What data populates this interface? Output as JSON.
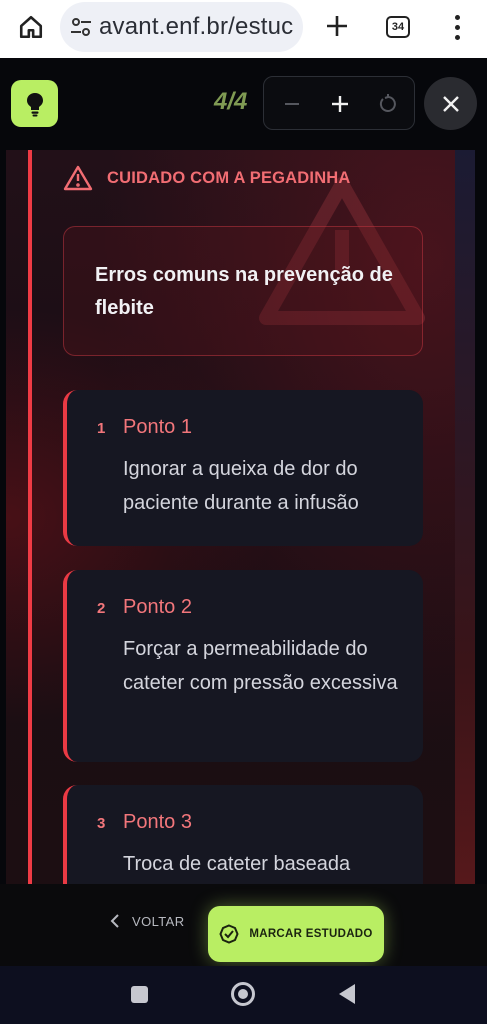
{
  "browser": {
    "url": "avant.enf.br/estuc",
    "tab_count": "34"
  },
  "app": {
    "counter": "4/4",
    "warning_label": "CUIDADO COM A PEGADINHA",
    "card_title": "Erros comuns na prevenção de flebite",
    "points": [
      {
        "number": "1",
        "title": "Ponto 1",
        "text": "Ignorar a queixa de dor do paciente durante a infusão"
      },
      {
        "number": "2",
        "title": "Ponto 2",
        "text": "Forçar a permeabilidade do cateter com pressão excessiva"
      },
      {
        "number": "3",
        "title": "Ponto 3",
        "text": "Troca de cateter baseada"
      }
    ],
    "footer": {
      "back_label": "VOLTAR",
      "mark_label": "MARCAR ESTUDADO"
    }
  },
  "icons": {
    "home": "home-icon",
    "site_settings": "tune-icon",
    "new_tab": "plus-icon",
    "menu": "more-vert-icon",
    "bulb": "lightbulb-icon",
    "zoom_out": "minus-icon",
    "zoom_in": "plus-icon",
    "reset": "reset-icon",
    "close": "close-icon",
    "warning": "warning-triangle-icon",
    "back": "chevron-left-icon",
    "check": "check-circle-icon"
  },
  "colors": {
    "accent_green": "#b9ee63",
    "alert_red": "#ef3b45",
    "alert_text": "#f26d73",
    "background": "#06070b"
  }
}
